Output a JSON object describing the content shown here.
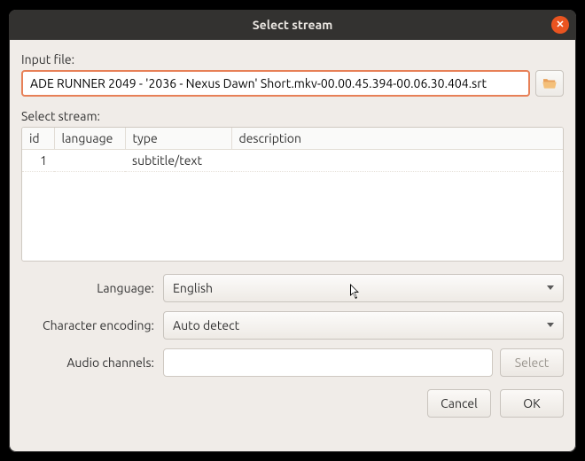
{
  "window": {
    "title": "Select stream"
  },
  "inputFile": {
    "label": "Input file:",
    "value": "ADE RUNNER 2049 - '2036 - Nexus Dawn' Short.mkv-00.00.45.394-00.06.30.404.srt"
  },
  "streamSection": {
    "label": "Select stream:"
  },
  "table": {
    "headers": {
      "id": "id",
      "language": "language",
      "type": "type",
      "description": "description"
    },
    "rows": [
      {
        "id": "1",
        "language": "",
        "type": "subtitle/text",
        "description": ""
      }
    ]
  },
  "form": {
    "languageLabel": "Language:",
    "languageValue": "English",
    "encodingLabel": "Character encoding:",
    "encodingValue": "Auto detect",
    "audioLabel": "Audio channels:",
    "audioValue": "",
    "selectLabel": "Select"
  },
  "footer": {
    "cancel": "Cancel",
    "ok": "OK"
  }
}
